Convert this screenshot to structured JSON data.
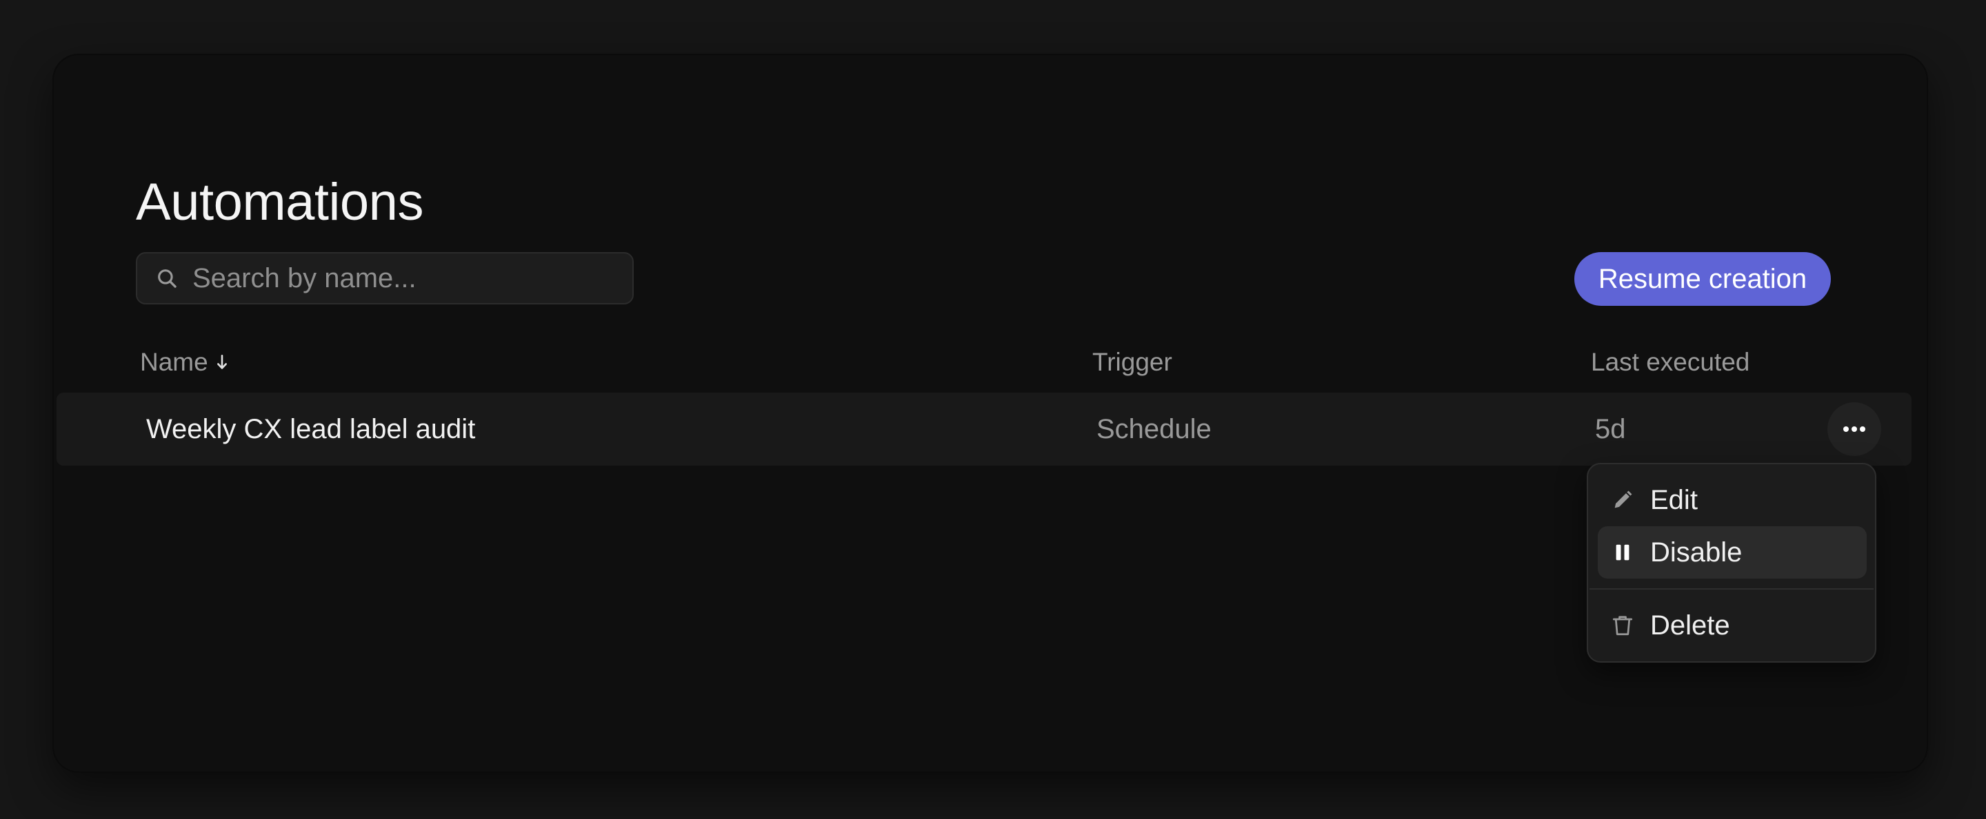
{
  "page": {
    "title": "Automations"
  },
  "search": {
    "placeholder": "Search by name...",
    "value": ""
  },
  "actions": {
    "primary_label": "Resume creation"
  },
  "table": {
    "columns": [
      {
        "label": "Name",
        "sort": "descending"
      },
      {
        "label": "Trigger"
      },
      {
        "label": "Last executed"
      }
    ],
    "rows": [
      {
        "name": "Weekly CX lead label audit",
        "trigger": "Schedule",
        "last_executed": "5d"
      }
    ]
  },
  "row_menu": {
    "items": [
      {
        "label": "Edit",
        "icon": "pencil-icon"
      },
      {
        "label": "Disable",
        "icon": "pause-icon"
      },
      {
        "label": "Delete",
        "icon": "trash-icon"
      }
    ],
    "highlighted": "Disable"
  },
  "colors": {
    "background": "#161616",
    "window": "#0f0f0f",
    "accent": "#5f64d6",
    "row": "#191919",
    "menu": "#1c1c1c"
  },
  "icons": {
    "search": "search-icon",
    "sort": "arrow-down-icon",
    "more": "more-horizontal-icon"
  }
}
